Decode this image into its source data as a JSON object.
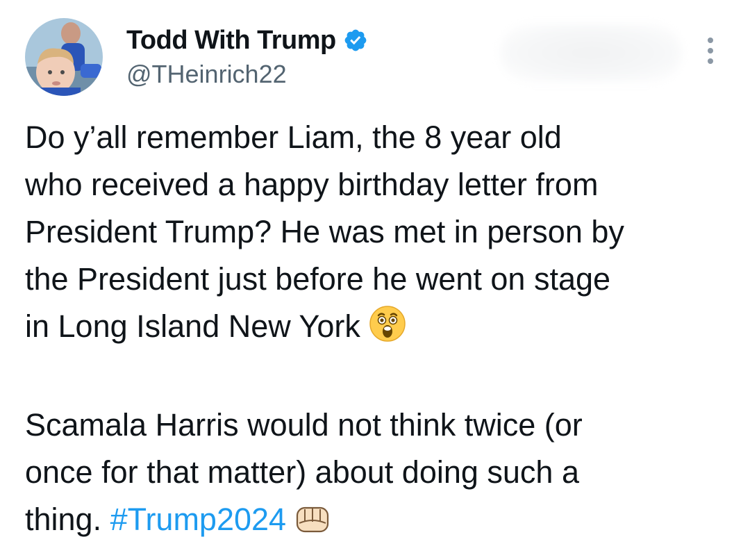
{
  "author": {
    "display_name": "Todd With Trump",
    "handle": "@THeinrich22",
    "verified_icon": "verified-badge-icon",
    "verified_color": "#1d9bf0"
  },
  "actions": {
    "more_icon": "more-dots-icon"
  },
  "tweet": {
    "paragraph1": {
      "lines": [
        "Do y’all remember Liam, the 8 year old",
        "who received a happy birthday letter from",
        "President Trump? He was met in person by",
        "the President just before he went on stage",
        "in Long Island New York "
      ],
      "emoji": "astonished-face-emoji"
    },
    "paragraph2": {
      "lines": [
        "Scamala Harris would not think twice (or",
        "once for that matter) about doing such a",
        "thing. "
      ],
      "hashtag": "#Trump2024",
      "emoji": "oncoming-fist-emoji"
    }
  },
  "colors": {
    "text": "#0f1419",
    "secondary": "#536471",
    "link": "#1d9bf0"
  }
}
